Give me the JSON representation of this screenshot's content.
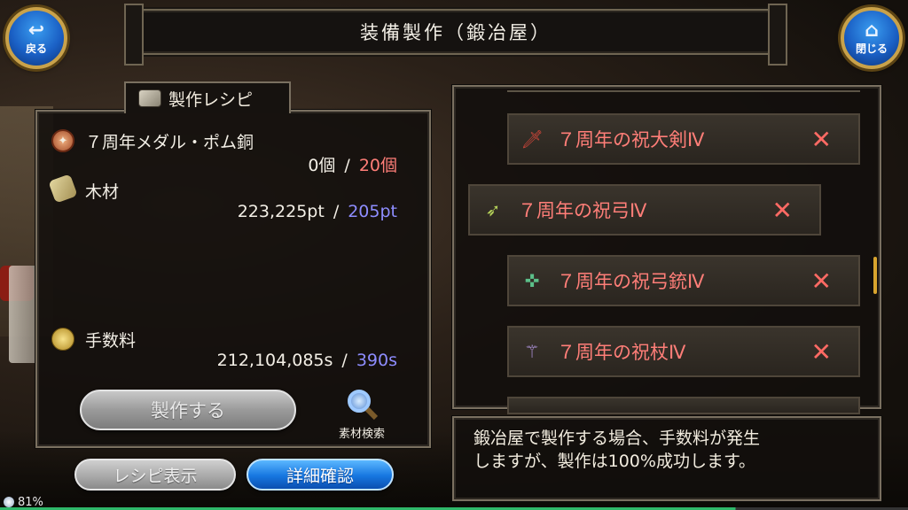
{
  "header": {
    "title": "装備製作（鍛冶屋）",
    "back_label": "戻る",
    "close_label": "閉じる"
  },
  "recipe": {
    "tab_label": "製作レシピ",
    "materials": [
      {
        "name": "７周年メダル・ポム銅",
        "have": "0個",
        "need": "20個",
        "icon": "medal-icon"
      },
      {
        "name": "木材",
        "have": "223,225pt",
        "need": "205pt",
        "icon": "wood-icon"
      }
    ],
    "fee": {
      "name": "手数料",
      "have": "212,104,085s",
      "need": "390s",
      "icon": "coin-icon"
    },
    "separator": "/",
    "make_label": "製作する",
    "search_label": "素材検索",
    "recipe_view_label": "レシピ表示",
    "detail_label": "詳細確認"
  },
  "list": {
    "items": [
      {
        "name": "７周年の祝大剣Ⅳ",
        "icon": "sword-icon",
        "mark": "✕"
      },
      {
        "name": "７周年の祝弓Ⅳ",
        "icon": "bow-icon",
        "mark": "✕",
        "selected": true
      },
      {
        "name": "７周年の祝弓銃Ⅳ",
        "icon": "crossbow-icon",
        "mark": "✕"
      },
      {
        "name": "７周年の祝杖Ⅳ",
        "icon": "staff-icon",
        "mark": "✕"
      }
    ]
  },
  "info": {
    "text_line1": "鍛冶屋で製作する場合、手数料が発生",
    "text_line2": "しますが、製作は100%成功します。"
  },
  "status": {
    "battery": "81%",
    "battery_level": 0.81
  },
  "colors": {
    "need_red": "#ff7e78",
    "need_blue": "#8e8dff",
    "accent_gold": "#c9a24a"
  }
}
